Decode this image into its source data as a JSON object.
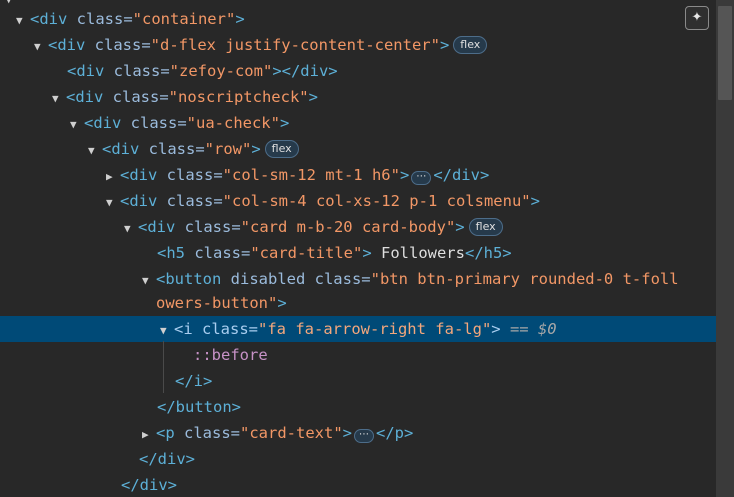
{
  "badges": {
    "flex": "flex",
    "ellipsis": "⋯"
  },
  "icons": {
    "expanded": "▼",
    "collapsed": "▶",
    "ai_assistant": "✦"
  },
  "lines": {
    "l0": {
      "open": "<div",
      "attr": " class=",
      "val": "\"container\"",
      "close": ">"
    },
    "l1": {
      "open": "<div",
      "attr": " class=",
      "val": "\"d-flex justify-content-center\"",
      "close": ">"
    },
    "l2": {
      "open": "<div",
      "attr": " class=",
      "val": "\"zefoy-com\"",
      "close": "></div>"
    },
    "l3": {
      "open": "<div",
      "attr": " class=",
      "val": "\"noscriptcheck\"",
      "close": ">"
    },
    "l4": {
      "open": "<div",
      "attr": " class=",
      "val": "\"ua-check\"",
      "close": ">"
    },
    "l5": {
      "open": "<div",
      "attr": " class=",
      "val": "\"row\"",
      "close": ">"
    },
    "l6": {
      "open": "<div",
      "attr": " class=",
      "val": "\"col-sm-12 mt-1 h6\"",
      "close": ">",
      "end": "</div>"
    },
    "l7": {
      "open": "<div",
      "attr": " class=",
      "val": "\"col-sm-4 col-xs-12 p-1 colsmenu\"",
      "close": ">"
    },
    "l8": {
      "open": "<div",
      "attr": " class=",
      "val": "\"card m-b-20 card-body\"",
      "close": ">"
    },
    "l9": {
      "open": "<h5",
      "attr": " class=",
      "val": "\"card-title\"",
      "close": ">",
      "text": " Followers",
      "end": "</h5>"
    },
    "l10": {
      "open": "<button",
      "attr": " disabled class=",
      "val": "\"btn btn-primary rounded-0 t-foll",
      "val2": "owers-button\"",
      "close": ">"
    },
    "l11": {
      "open": "<i",
      "attr": " class=",
      "val": "\"fa fa-arrow-right fa-lg\"",
      "close": ">",
      "eq": " == ",
      "dollar": "$0"
    },
    "l12": {
      "pseudo": "::before"
    },
    "l13": {
      "end": "</i>"
    },
    "l14": {
      "end": "</button>"
    },
    "l15": {
      "open": "<p",
      "attr": " class=",
      "val": "\"card-text\"",
      "close": ">",
      "end": "</p>"
    },
    "l16": {
      "end": "</div>"
    },
    "l17": {
      "end": "</div>"
    }
  }
}
